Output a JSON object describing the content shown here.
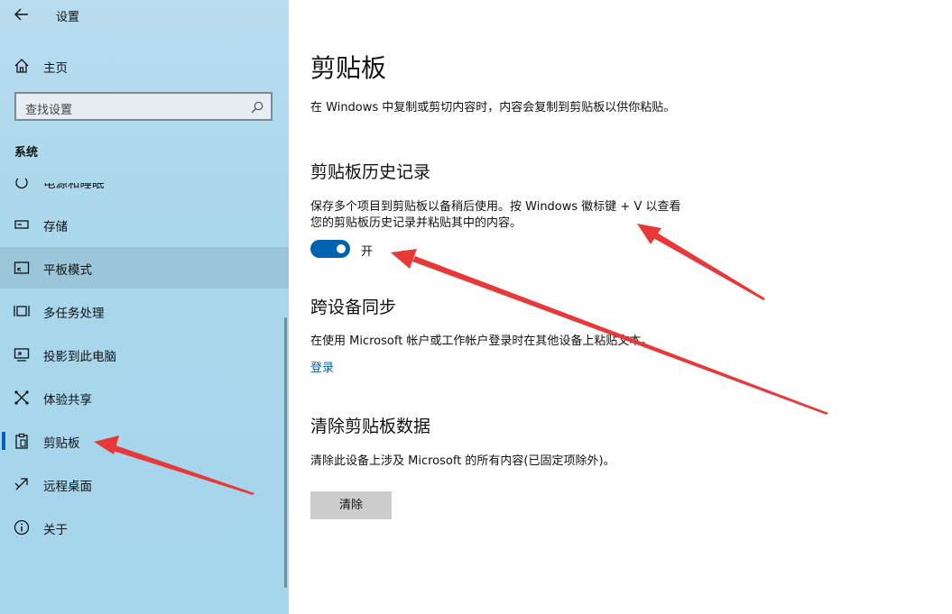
{
  "window": {
    "title": "设置"
  },
  "sidebar": {
    "home_label": "主页",
    "search_placeholder": "查找设置",
    "section_label": "系统",
    "items": [
      {
        "label": "电源和睡眠",
        "icon": "power-icon"
      },
      {
        "label": "存储",
        "icon": "storage-icon"
      },
      {
        "label": "平板模式",
        "icon": "tablet-icon"
      },
      {
        "label": "多任务处理",
        "icon": "multitasking-icon"
      },
      {
        "label": "投影到此电脑",
        "icon": "projection-icon"
      },
      {
        "label": "体验共享",
        "icon": "share-icon"
      },
      {
        "label": "剪贴板",
        "icon": "clipboard-icon"
      },
      {
        "label": "远程桌面",
        "icon": "remote-desktop-icon"
      },
      {
        "label": "关于",
        "icon": "info-icon"
      }
    ],
    "selected_item": "剪贴板"
  },
  "main": {
    "title": "剪贴板",
    "intro": "在 Windows 中复制或剪切内容时，内容会复制到剪贴板以供你粘贴。",
    "history": {
      "heading": "剪贴板历史记录",
      "desc_line1": "保存多个项目到剪贴板以备稍后使用。按 Windows 徽标键 + V 以查看",
      "desc_line2": "您的剪贴板历史记录并粘贴其中的内容。",
      "toggle_state": "开"
    },
    "sync": {
      "heading": "跨设备同步",
      "desc": "在使用 Microsoft 帐户或工作帐户登录时在其他设备上粘贴文本。",
      "link": "登录"
    },
    "clear": {
      "heading": "清除剪贴板数据",
      "desc": "清除此设备上涉及 Microsoft 的所有内容(已固定项除外)。",
      "button": "清除"
    }
  },
  "colors": {
    "accent": "#0063b1",
    "annotation": "#e8393a",
    "sidebar_bg": "#a9d7ec"
  }
}
